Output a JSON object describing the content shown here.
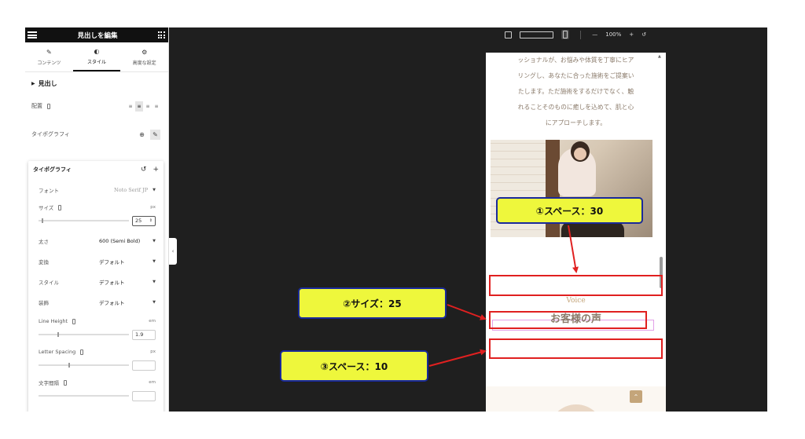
{
  "sidebar": {
    "title": "見出しを編集",
    "tabs": [
      {
        "label": "コンテンツ",
        "icon": "pencil-icon"
      },
      {
        "label": "スタイル",
        "icon": "half-circle-icon",
        "active": true
      },
      {
        "label": "高度な設定",
        "icon": "gear-icon"
      }
    ],
    "section_title": "見出し",
    "alignment_label": "配置",
    "typography_label": "タイポグラフィ",
    "popover": {
      "title": "タイポグラフィ",
      "font_label": "フォント",
      "font_value": "Noto Serif JP",
      "size_label": "サイズ",
      "size_unit": "px",
      "size_value": "25",
      "weight_label": "太さ",
      "weight_value": "600 (Semi Bold)",
      "transform_label": "変換",
      "transform_value": "デフォルト",
      "style_label": "スタイル",
      "style_value": "デフォルト",
      "decoration_label": "装飾",
      "decoration_value": "デフォルト",
      "line_height_label": "Line Height",
      "line_height_unit": "em",
      "line_height_value": "1.9",
      "letter_spacing_label": "Letter Spacing",
      "letter_spacing_unit": "px",
      "word_spacing_label": "文字間隔",
      "word_spacing_unit": "em"
    }
  },
  "toolbar": {
    "zoom": "100%",
    "minus": "—",
    "plus": "+",
    "undo": "↺"
  },
  "preview": {
    "paragraph_lines": [
      "ッショナルが、お悩みや体質を丁寧にヒア",
      "リングし、あなたに合った施術をご提案い",
      "たします。ただ施術をするだけでなく、触",
      "れることそのものに癒しを込めて、肌と心",
      "にアプローチします。"
    ],
    "voice_label": "Voice",
    "heading": "お客様の声"
  },
  "annotations": {
    "callout1": "①スペース：30",
    "callout2": "②サイズ：25",
    "callout3": "③スペース：10"
  },
  "colors": {
    "annotation_red": "#e02020",
    "callout_fill": "#eef73c",
    "callout_border": "#1a2a9a",
    "accent_gold": "#c4a57a"
  }
}
